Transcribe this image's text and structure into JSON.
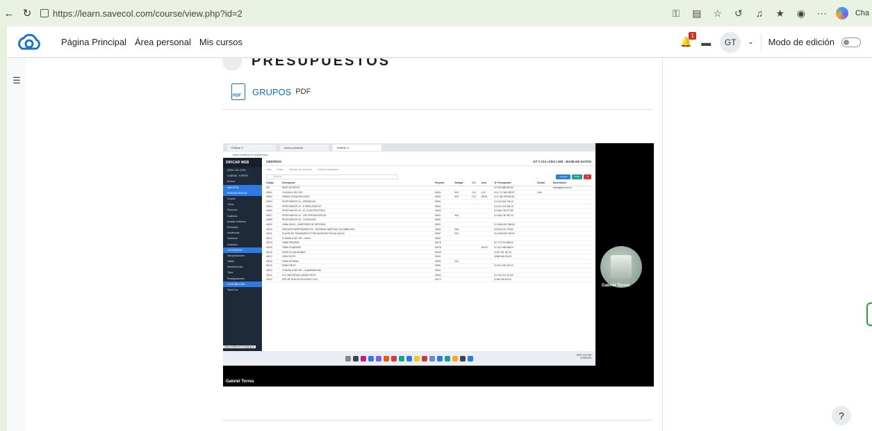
{
  "browser": {
    "url": "https://learn.savecol.com/course/view.php?id=2",
    "extension_label": "Cha"
  },
  "topnav": {
    "links": [
      "Página Principal",
      "Área personal",
      "Mis cursos"
    ],
    "notification_count": "1",
    "user_initials": "GT",
    "edit_mode_label": "Modo de edición"
  },
  "section": {
    "title": "PRESUPUESTOS",
    "activity_name": "GRUPOS",
    "activity_type": "PDF",
    "pdf_icon_text": "PDF"
  },
  "video": {
    "presenter": "Gabriel Torres",
    "browser_tabs": [
      "Edificar 0",
      "Nueva pestaña",
      "Edificar 0"
    ],
    "address": "https://edificar10.net/centros",
    "status_link": "https://edificar10.net/grupos",
    "app": {
      "brand": "DIFICAR WEB",
      "company": "GT Y CIA LTDA | 000 - BASE DE DATOS",
      "page": "CENTROS",
      "tabs": [
        "Lista",
        "Notas",
        "Filtrados de Contexto",
        "Control Indicadores"
      ],
      "search_placeholder": "Buscar",
      "buttons": [
        "+ Agregar",
        "Filtrar"
      ],
      "sidebar": [
        "ABRIL DEL 2025",
        "GABRIEL TORRES",
        "Buscar",
        "MAESTRA",
        "PRESUPUESTOS",
        "Grupos",
        "Libros",
        "Recursos",
        "Capítulos",
        "Análisis Unitarios",
        "Resultado",
        "Incidencias",
        "Indirectos",
        "Unidades",
        "CONTRATOS",
        "Interpretaciones",
        "Tablas",
        "Dependencias",
        "Tipos",
        "Reasignaciones",
        "CONTABILIDAD",
        "Tipos Doc"
      ],
      "columns": [
        "Código",
        "Descripción",
        "Proyecto",
        "Bodega",
        "C.C.",
        "Area",
        "Vr. Presupuesto",
        "Ciudad",
        "Observación"
      ],
      "rows": [
        [
          "001",
          "BASE DE DATOS",
          "",
          "",
          "",
          "",
          "$ 3.978.389.819,00",
          "",
          "www.gtycia.com.co"
        ],
        [
          "00001",
          "CUSADILA DEL RIO",
          "00001",
          "B01",
          "C01",
          "LD0",
          "$ 14.717.363.298,57",
          "CALI",
          ""
        ],
        [
          "00002",
          "OBRAS CIUDAD BOLIVAR",
          "00001",
          "B01",
          "C02",
          "00001",
          "$ 11.280.759.949,40",
          "",
          ""
        ],
        [
          "00003",
          "PROPONENTE 01 - GERENCIAS",
          "00001",
          "",
          "",
          "",
          "$ 3.216.616.708,10",
          "",
          ""
        ],
        [
          "00004",
          "PROPONENTE 02 - E PRESUPUESTO",
          "00001",
          "",
          "",
          "",
          "$ 3.012.222.846,15",
          "",
          ""
        ],
        [
          "00005",
          "PROPONENTE 03 - AC CONSTRUCTORA",
          "00002",
          "",
          "",
          "",
          "$ 3.286.739.072,56",
          "",
          ""
        ],
        [
          "00007",
          "PROPONENTE 04 - CPE PRESUPUESTOS",
          "00001",
          "B04",
          "",
          "",
          "$ 2.846.190.087,00",
          "",
          ""
        ],
        [
          "00008",
          "PROPONENTE 05 - CONSTALES",
          "00001",
          "",
          "",
          "",
          "",
          "",
          ""
        ],
        [
          "00009",
          "OBRA DEMO - MINISTERIO DE DEFENSA",
          "00001",
          "",
          "",
          "",
          "$ 13.850.322.398,60",
          "",
          ""
        ],
        [
          "00010",
          "PARQUES IMPERTAMIENTOS - JERONIMO MARTINS COLOMBIA SAS",
          "00001",
          "B06",
          "",
          "",
          "$ 8.203.212.729,60",
          "",
          ""
        ],
        [
          "00011",
          "PLANTA DE TRATAMIENTO PTAR MUNICIPIO SILVIA CAUCA",
          "00007",
          "B10",
          "",
          "",
          "$ 14.849.025.738,05",
          "",
          ""
        ],
        [
          "00012",
          "CUSADILA DEL RIO - IDEAL",
          "00001",
          "",
          "",
          "",
          "",
          "",
          ""
        ],
        [
          "00013",
          "OBRA ORIGINAL",
          "00078",
          "",
          "",
          "",
          "$ 1.373.074.859,00",
          "",
          ""
        ],
        [
          "00015",
          "OBRA STANDARS",
          "00078",
          "",
          "",
          "00015",
          "$ 1.614.098.988,00",
          "",
          ""
        ],
        [
          "00016",
          "EDIFICIO SALUDABLE",
          "00008",
          "",
          "",
          "",
          "$ 232.751.187,00",
          "",
          ""
        ],
        [
          "00017",
          "DEMO ELITE",
          "00001",
          "",
          "",
          "",
          "$ 868.065.230,00",
          "",
          ""
        ],
        [
          "00018",
          "OBRA ESTADAL",
          "00001",
          "B11",
          "",
          "",
          "",
          "",
          ""
        ],
        [
          "00019",
          "DEMO REVIT",
          "00001",
          "",
          "",
          "",
          "$ 2.871.330.407,00",
          "",
          ""
        ],
        [
          "00020",
          "CUSADILA DEL RIO - SUMAREDIONA",
          "00001",
          "",
          "",
          "",
          "",
          "",
          ""
        ],
        [
          "00021",
          "SGT IMPORTADO DESDE REVIT",
          "00002",
          "",
          "",
          "",
          "$ 4.792.741.213,00",
          "",
          ""
        ],
        [
          "00022",
          "RED DE RUICOS EN ACERO 1010",
          "00073",
          "",
          "",
          "",
          "$ 383.638.300,00",
          "",
          ""
        ]
      ],
      "tray_lang": "ESP",
      "tray_time": "2:30 PM",
      "tray_date": "4/28/2025"
    }
  },
  "colors": {
    "accent": "#0f6cbf",
    "sidebar_bg": "#1e2a3a",
    "sidebar_highlight": "#2d7be0"
  }
}
